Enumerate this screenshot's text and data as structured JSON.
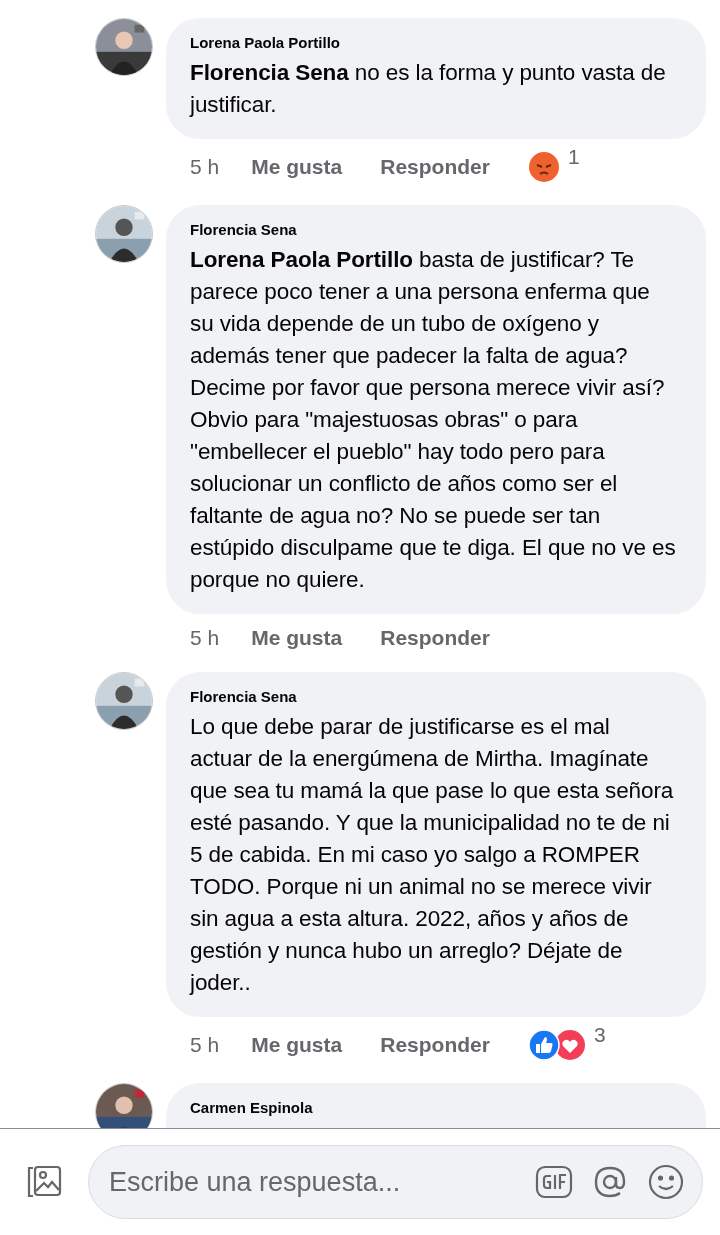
{
  "comments": [
    {
      "author": "Lorena Paola Portillo",
      "body": "**Florencia Sena** no es la forma y punto vasta de justificar.",
      "meta": {
        "time": "5 h",
        "like": "Me gusta",
        "reply": "Responder"
      },
      "reactions": {
        "kinds": [
          {
            "kind": "angry"
          }
        ],
        "count": "1"
      }
    },
    {
      "author": "Florencia Sena",
      "body": "**Lorena Paola Portillo** basta de justificar? Te parece poco tener a una persona enferma que su vida depende de un tubo de oxígeno y además tener que padecer la falta de agua? Decime por favor que persona merece vivir así? Obvio para \"majestuosas obras\" o para \"embellecer el pueblo\" hay todo pero para solucionar un conflicto de años como ser el faltante de agua no? No se puede ser tan estúpido disculpame que te diga. El que no ve es porque no quiere.",
      "meta": {
        "time": "5 h",
        "like": "Me gusta",
        "reply": "Responder"
      }
    },
    {
      "author": "Florencia Sena",
      "body": "Lo que debe parar de justificarse es el mal actuar de la energúmena de Mirtha. Imagínate que sea tu mamá la que pase lo que esta señora esté pasando. Y que la municipalidad no te de ni 5 de cabida. En mi caso yo salgo a ROMPER TODO. Porque ni un animal no se merece vivir sin agua a esta altura. 2022, años y años de gestión y nunca hubo un arreglo? Déjate de joder..",
      "meta": {
        "time": "5 h",
        "like": "Me gusta",
        "reply": "Responder"
      },
      "reactions": {
        "kinds": [
          {
            "kind": "like"
          },
          {
            "kind": "love"
          }
        ],
        "count": "3"
      }
    },
    {
      "author": "Carmen Espinola"
    }
  ],
  "composer": {
    "placeholder": "Escribe una respuesta..."
  }
}
